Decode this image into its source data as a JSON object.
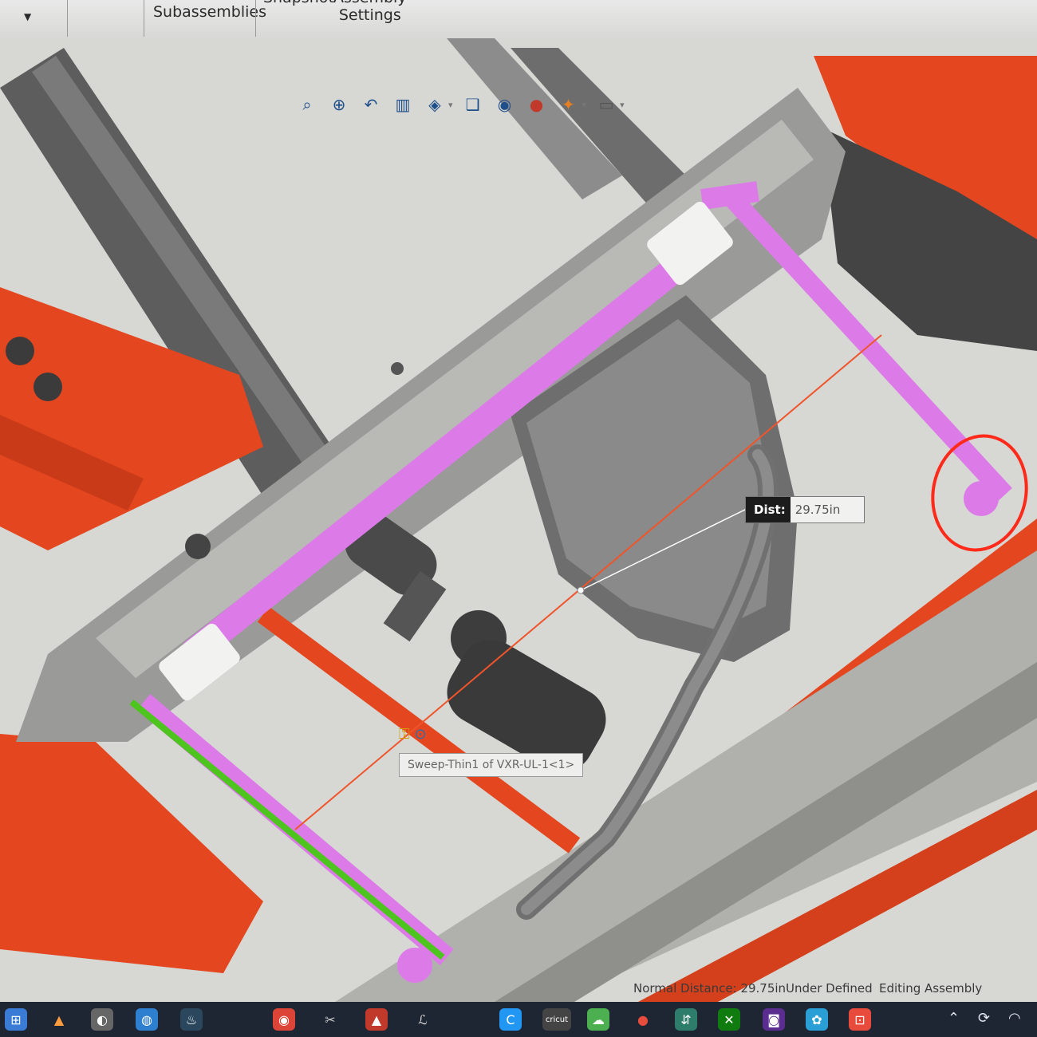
{
  "ribbon": {
    "subassemblies_label": "Subassemblies",
    "snapshot_label": "Snapshot",
    "assembly_label": "Assembly",
    "settings_label": "Settings"
  },
  "view_toolbar": {
    "icons": [
      "zoom-to-fit-icon",
      "zoom-to-area-icon",
      "previous-view-icon",
      "section-view-icon",
      "view-orientation-icon",
      "display-style-icon",
      "hide-show-items-icon",
      "edit-appearance-icon",
      "apply-scene-icon",
      "view-settings-icon"
    ]
  },
  "measure": {
    "dist_label": "Dist:",
    "dist_value": "29.75in"
  },
  "tooltip": {
    "text": "Sweep-Thin1 of VXR-UL-1<1>"
  },
  "status": {
    "normal_distance": "Normal Distance: 29.75in",
    "definition": "Under Defined",
    "mode": "Editing Assembly"
  },
  "taskbar": {
    "apps": [
      "windows-start",
      "file-explorer",
      "chrome",
      "steam",
      "cricut",
      "onedrive",
      "xbox",
      "paint"
    ],
    "cricut_label": "cricut"
  },
  "colors": {
    "frame_red": "#e4471f",
    "link_pink": "#dc7be8",
    "edge_green": "#4ec41e",
    "dist_red": "#f0542a",
    "highlight_circle": "#ff2a1a"
  }
}
